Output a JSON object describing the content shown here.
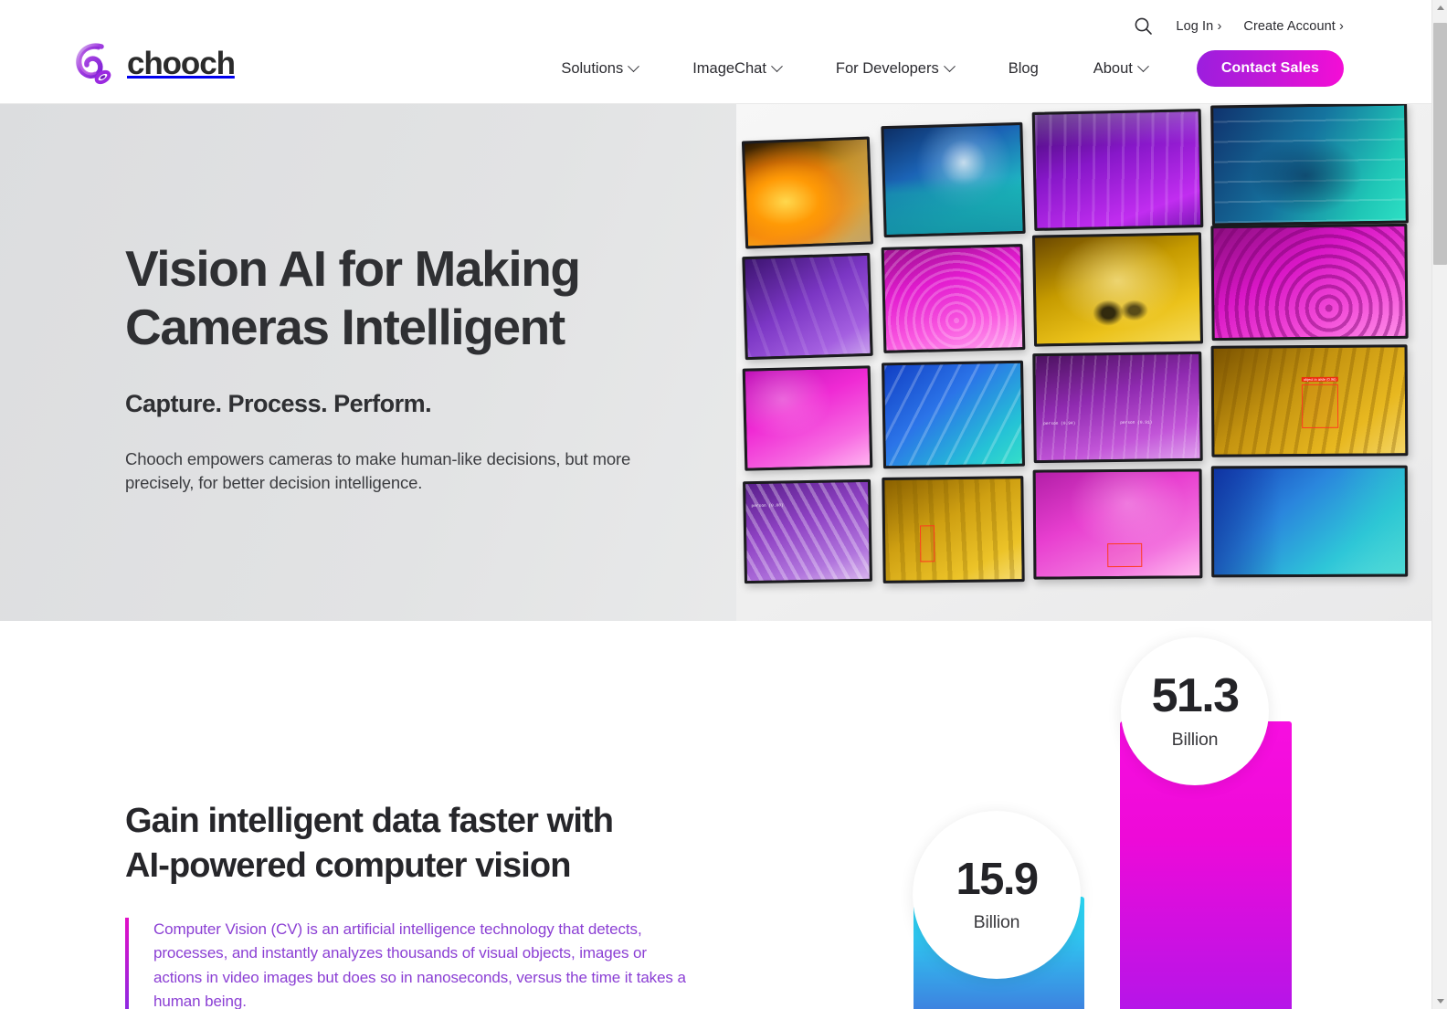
{
  "brand": {
    "name": "chooch",
    "logo_icon": "chooch-swirl-logo"
  },
  "utility": {
    "search_icon": "search-icon",
    "login_label": "Log In ›",
    "create_account_label": "Create Account ›"
  },
  "nav": {
    "items": [
      {
        "label": "Solutions",
        "has_dropdown": true
      },
      {
        "label": "ImageChat",
        "has_dropdown": true
      },
      {
        "label": "For Developers",
        "has_dropdown": true
      },
      {
        "label": "Blog",
        "has_dropdown": false
      },
      {
        "label": "About",
        "has_dropdown": true
      }
    ],
    "cta_label": "Contact Sales",
    "cta_color": "#bf19d8"
  },
  "hero": {
    "title_line1": "Vision AI for Making",
    "title_line2": "Cameras Intelligent",
    "subtitle": "Capture. Process. Perform.",
    "body": "Chooch empowers cameras to make human-like decisions, but more precisely, for better decision intelligence.",
    "image_alt": "monitor-wall-collage"
  },
  "section2": {
    "heading_line1": "Gain intelligent data faster with",
    "heading_line2": "AI-powered computer vision",
    "quote": "Computer Vision (CV) is an artificial intelligence technology that detects, processes, and instantly analyzes thousands of visual objects, images or actions in video images but does so in nanoseconds, versus the time it takes a human being.",
    "quote_color": "#8b3fd4"
  },
  "chart_data": {
    "type": "bar",
    "title": "",
    "categories": [
      "15.9",
      "51.3"
    ],
    "values": [
      15.9,
      51.3
    ],
    "unit": "Billion",
    "series": [
      {
        "name": "smaller-stat",
        "value": 15.9,
        "unit": "Billion",
        "color_start": "#2ad9f5",
        "color_end": "#3d83e0"
      },
      {
        "name": "larger-stat",
        "value": 51.3,
        "unit": "Billion",
        "color_start": "#f70ee0",
        "color_end": "#b615e8"
      }
    ],
    "xlabel": "",
    "ylabel": "",
    "grid": false,
    "legend": "none"
  },
  "stats": {
    "bar1": {
      "value": "15.9",
      "unit": "Billion"
    },
    "bar2": {
      "value": "51.3",
      "unit": "Billion"
    }
  },
  "scrollbar": {
    "up_icon": "scroll-up-arrow-icon",
    "down_icon": "scroll-down-arrow-icon"
  }
}
